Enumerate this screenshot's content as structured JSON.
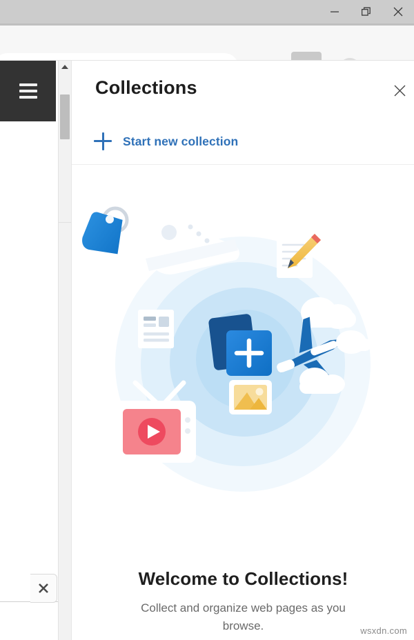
{
  "window": {
    "controls": [
      {
        "name": "minimize",
        "label": "Minimize",
        "glyph": "minimize-icon"
      },
      {
        "name": "restore",
        "label": "Restore",
        "glyph": "restore-icon"
      },
      {
        "name": "close",
        "label": "Close",
        "glyph": "close-icon"
      }
    ]
  },
  "toolbar": {
    "read_aloud": "read-aloud-icon",
    "add_favorite": "add-favorite-star-icon",
    "favorites_list": "favorites-list-icon",
    "collections": "collections-icon",
    "profile": "profile-avatar-icon",
    "more": "more-settings-icon",
    "collections_active": true,
    "active_bg": "#c9c9c9"
  },
  "page": {
    "hamburger": "hamburger-menu-icon",
    "close_button": "close-icon"
  },
  "scrollbar": {
    "up_arrow": "scroll-up-arrow-icon"
  },
  "panel": {
    "title": "Collections",
    "close_label": "close-icon",
    "start_new_collection": "Start new collection",
    "accent_color": "#2f71b8"
  },
  "empty_state": {
    "heading": "Welcome to Collections!",
    "description": "Collect and organize web pages as you browse.",
    "illustration": {
      "name": "collections-empty-illustration",
      "items": [
        "price-tag-icon",
        "sneaker-icon",
        "note-with-pencil-icon",
        "article-card-icon",
        "stacked-cards-plus-icon",
        "airplane-with-clouds-icon",
        "photo-thumbnail-icon",
        "tv-with-play-icon"
      ],
      "colors": {
        "halo_outer": "#eef6fd",
        "halo_mid": "#d9ecfa",
        "halo_inner": "#bcdff6",
        "blue_dark": "#1b5496",
        "blue_bright": "#1a7ed6",
        "tag_blue": "#1a84d6",
        "plane_blue": "#1a6bb5",
        "tv_pink": "#f5838c",
        "play_pink": "#ee4a5f",
        "photo_yellow": "#f2c055",
        "pencil_yellow": "#f2c94c"
      }
    }
  },
  "watermark": "wsxdn.com"
}
